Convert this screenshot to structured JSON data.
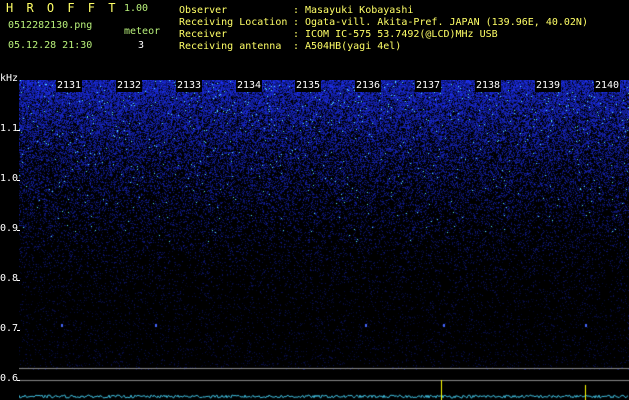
{
  "app": {
    "title": "H R O F F T",
    "version": "1.00",
    "filename": "0512282130.png",
    "datetime": "05.12.28 21:30",
    "meteor_label": "meteor",
    "meteor_count": "3"
  },
  "info": [
    {
      "key": "Observer",
      "value": "Masayuki Kobayashi"
    },
    {
      "key": "Receiving Location",
      "value": "Ogata-vill. Akita-Pref. JAPAN (139.96E, 40.02N)"
    },
    {
      "key": "Receiver",
      "value": "ICOM IC-575 53.7492(@LCD)MHz USB"
    },
    {
      "key": "Receiving antenna",
      "value": "A504HB(yagi 4el)"
    }
  ],
  "axis": {
    "unit": "kHz",
    "ticks": [
      "1.1",
      "1.0",
      "0.9",
      "0.8",
      "0.7",
      "0.6"
    ]
  },
  "time_labels": [
    "2131",
    "2132",
    "2133",
    "2134",
    "2135",
    "2136",
    "2137",
    "2138",
    "2139",
    "2140"
  ],
  "colors": {
    "background": "#000000",
    "title": "#ffff66",
    "meta": "#b8f07a",
    "text": "#ffffff",
    "noise": "#2a3cff",
    "noise_bright": "#66ffff",
    "baseline": "#40c0e0",
    "meteor_trace": "#ffff00"
  }
}
